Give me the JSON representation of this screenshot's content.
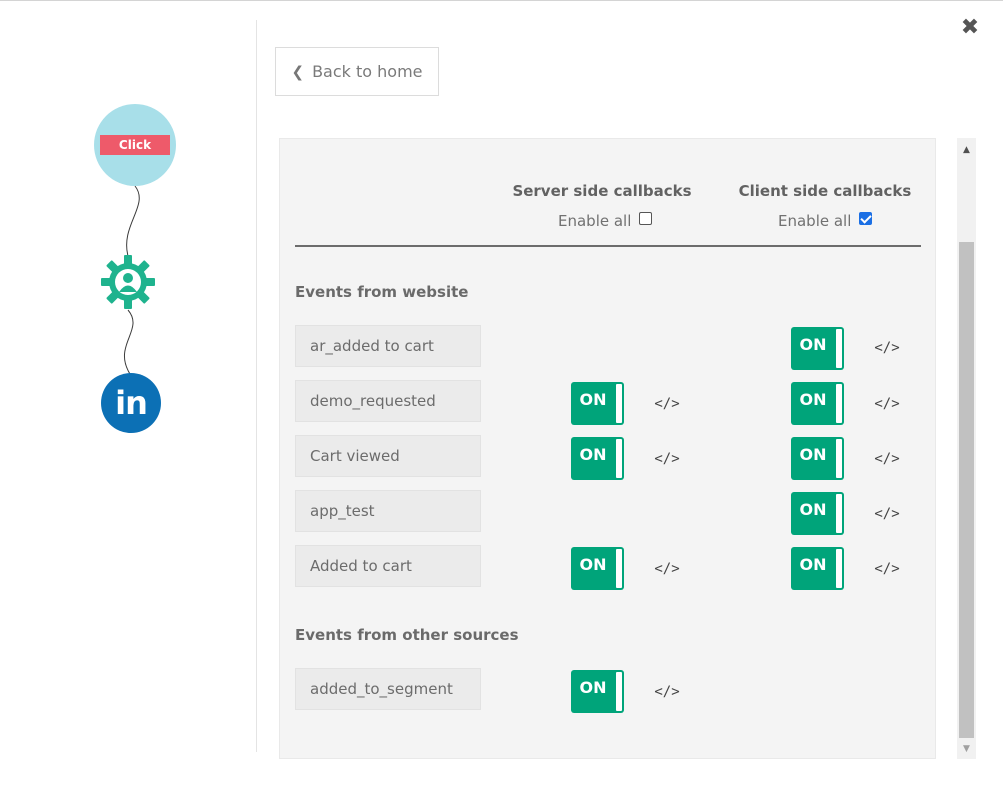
{
  "nav": {
    "back_label": "Back to home",
    "close_glyph": "✖"
  },
  "flow": {
    "click_label": "Click",
    "linkedin_label": "in"
  },
  "columns": {
    "server": {
      "title": "Server side callbacks",
      "enable_all": "Enable all",
      "enabled": false
    },
    "client": {
      "title": "Client side callbacks",
      "enable_all": "Enable all",
      "enabled": true
    }
  },
  "sections": {
    "website": {
      "title": "Events from website",
      "events": [
        {
          "name": "ar_added to cart",
          "server": null,
          "client": "ON"
        },
        {
          "name": "demo_requested",
          "server": "ON",
          "client": "ON"
        },
        {
          "name": "Cart viewed",
          "server": "ON",
          "client": "ON"
        },
        {
          "name": "app_test",
          "server": null,
          "client": "ON"
        },
        {
          "name": "Added to cart",
          "server": "ON",
          "client": "ON"
        }
      ]
    },
    "other": {
      "title": "Events from other sources",
      "events": [
        {
          "name": "added_to_segment",
          "server": "ON",
          "client": null
        }
      ]
    }
  },
  "code_glyph": "</>",
  "colors": {
    "toggle_on": "#00a47a",
    "click_node": "#a8dfe9",
    "click_label": "#ee5a6a",
    "gear": "#1fb38e",
    "linkedin": "#0c70b5"
  }
}
